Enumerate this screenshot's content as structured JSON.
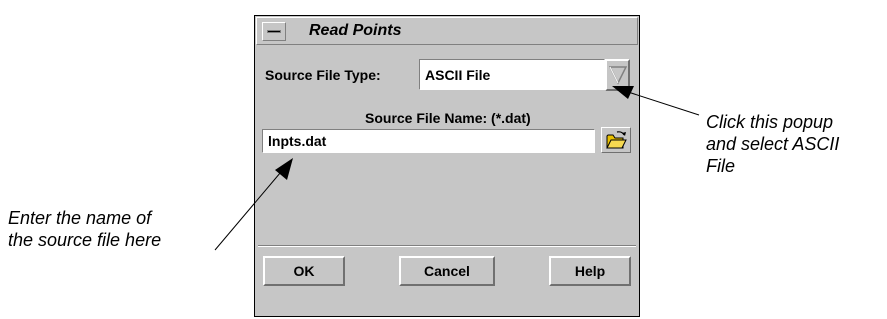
{
  "dialog": {
    "title": "Read Points",
    "source_type_label": "Source File Type:",
    "source_type_value": "ASCII File",
    "source_name_label": "Source File Name: (*.dat)",
    "source_name_value": "lnpts.dat",
    "buttons": {
      "ok": "OK",
      "cancel": "Cancel",
      "help": "Help"
    }
  },
  "annotations": {
    "popup_note": [
      "Click this popup",
      "and select ASCII",
      "File"
    ],
    "source_note": [
      "Enter the name of",
      "the source file here"
    ]
  },
  "icons": {
    "window_menu": "window-menu-icon",
    "popup": "dropdown-triangle-icon",
    "browse": "open-folder-icon"
  },
  "colors": {
    "dialog_bg": "#c6c6c6",
    "field_bg": "#ffffff",
    "folder": "#e8c000"
  }
}
